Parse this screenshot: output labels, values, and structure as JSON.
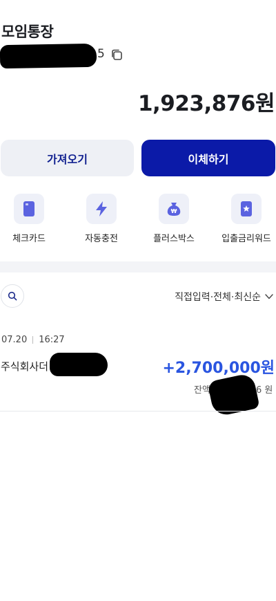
{
  "header": {
    "title": "모임통장",
    "account_suffix": "5",
    "icons": {
      "copy": "copy-icon"
    }
  },
  "balance": {
    "amount": "1,923,876원"
  },
  "actions": {
    "get_label": "가져오기",
    "transfer_label": "이체하기"
  },
  "quick_menu": {
    "items": [
      {
        "label": "체크카드",
        "icon": "card-icon"
      },
      {
        "label": "자동충전",
        "icon": "lightning-icon"
      },
      {
        "label": "플러스박스",
        "icon": "money-bag-icon"
      },
      {
        "label": "입출금리워드",
        "icon": "reward-card-icon"
      }
    ]
  },
  "history": {
    "filter_label": "직접입력·전체·최신순",
    "icons": {
      "search": "search-icon",
      "filter": "chevron-down-icon"
    },
    "transactions": [
      {
        "date": "07.20",
        "time": "16:27",
        "name": "주식회사더",
        "amount": "+2,700,000원",
        "balance_label": "잔액",
        "balance_suffix": "6 원"
      }
    ]
  },
  "colors": {
    "primary": "#0b1aa8",
    "secondary_bg": "#eef0f5",
    "icon_bg": "#eef0f8",
    "icon_fg": "#5b63e0",
    "deposit_amount": "#2a55e0"
  }
}
